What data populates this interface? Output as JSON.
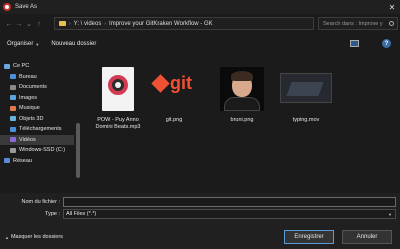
{
  "window": {
    "title": "Save As",
    "close_glyph": "✕"
  },
  "address": {
    "crumbs": [
      "Y: \\ videos",
      "Improve your GitKraken Workflow - GK"
    ],
    "separator": "›",
    "search_placeholder": "Search dans : Improve y"
  },
  "toolbar": {
    "organize_label": "Organiser",
    "new_folder_label": "Nouveau dossier",
    "help_glyph": "?"
  },
  "nav": {
    "items": [
      {
        "label": "Ce PC",
        "icon": "computer-icon",
        "color": "#6aa7e0",
        "indent": 0
      },
      {
        "label": "Bureau",
        "icon": "desktop-icon",
        "color": "#4a90d9",
        "indent": 1
      },
      {
        "label": "Documents",
        "icon": "documents-icon",
        "color": "#8a8a8a",
        "indent": 1
      },
      {
        "label": "Images",
        "icon": "images-icon",
        "color": "#5aa7e0",
        "indent": 1
      },
      {
        "label": "Musique",
        "icon": "music-icon",
        "color": "#e07a4a",
        "indent": 1
      },
      {
        "label": "Objets 3D",
        "icon": "objects-3d-icon",
        "color": "#6ab0e0",
        "indent": 1
      },
      {
        "label": "Téléchargements",
        "icon": "downloads-icon",
        "color": "#4a90d9",
        "indent": 1
      },
      {
        "label": "Vidéos",
        "icon": "videos-icon",
        "color": "#8a6ad9",
        "indent": 1,
        "selected": true
      },
      {
        "label": "Windows-SSD (C:)",
        "icon": "drive-icon",
        "color": "#9a9a9a",
        "indent": 1
      },
      {
        "label": "Réseau",
        "icon": "network-icon",
        "color": "#5a8ad9",
        "indent": 0
      }
    ]
  },
  "files": [
    {
      "label": "POW - Puy Anno Domini Beats.mp3",
      "type": "mp3"
    },
    {
      "label": "git.png",
      "type": "git",
      "logo_text": "git"
    },
    {
      "label": "bruni.png",
      "type": "photo"
    },
    {
      "label": "typing.mov",
      "type": "video"
    }
  ],
  "form": {
    "filename_label": "Nom du fichier :",
    "filename_value": "",
    "type_label": "Type :",
    "type_value": "All Files (*.*)"
  },
  "footer": {
    "hide_folders_label": "Masquer les dossiers",
    "save_label": "Enregistrer",
    "cancel_label": "Annuler"
  },
  "colors": {
    "accent": "#5b9bd5",
    "git": "#f05133"
  }
}
